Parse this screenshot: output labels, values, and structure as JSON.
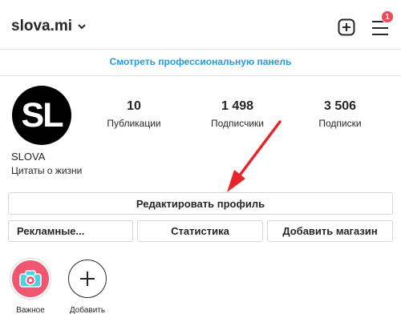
{
  "header": {
    "username": "slova.mi",
    "notifications_count": "1"
  },
  "pro_panel": {
    "label": "Смотреть профессиональную панель"
  },
  "profile": {
    "avatar_text": "SL",
    "display_name": "SLOVA",
    "bio": "Цитаты о жизни",
    "stats": {
      "posts": {
        "value": "10",
        "label": "Публикации"
      },
      "followers": {
        "value": "1 498",
        "label": "Подписчики"
      },
      "following": {
        "value": "3 506",
        "label": "Подписки"
      }
    }
  },
  "buttons": {
    "edit_profile": "Редактировать профиль",
    "ads": "Рекламные...",
    "statistics": "Статистика",
    "add_shop": "Добавить магазин"
  },
  "highlights": [
    {
      "label": "Важное",
      "icon": "camera-icon"
    },
    {
      "label": "Добавить",
      "icon": "plus-icon"
    }
  ],
  "colors": {
    "link_blue": "#1f9be8",
    "badge_red": "#ed4956",
    "arrow_red": "#e8262a",
    "highlight_pink": "#f0566f"
  }
}
